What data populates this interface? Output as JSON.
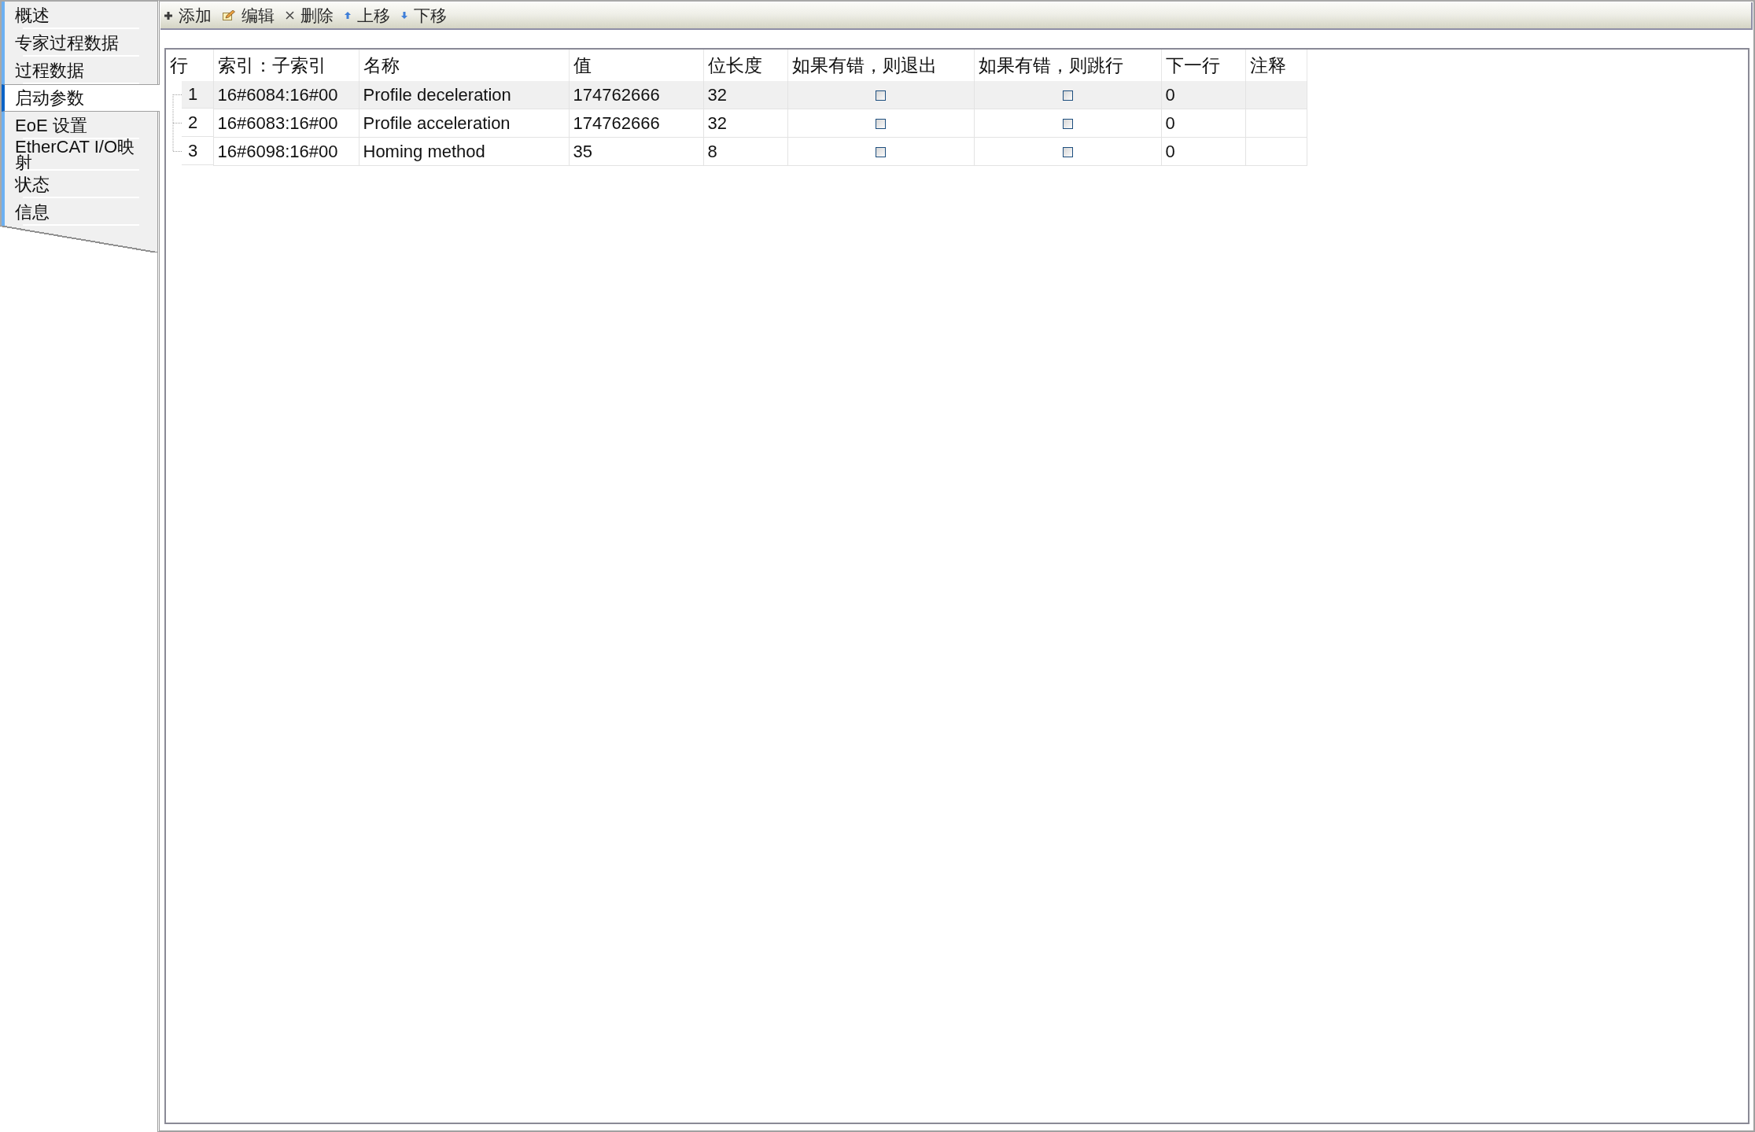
{
  "sidebar": {
    "items": [
      {
        "label": "概述",
        "selected": false
      },
      {
        "label": "专家过程数据",
        "selected": false
      },
      {
        "label": "过程数据",
        "selected": false
      },
      {
        "label": "启动参数",
        "selected": true
      },
      {
        "label": "EoE 设置",
        "selected": false
      },
      {
        "label": "EtherCAT I/O映射",
        "selected": false
      },
      {
        "label": "状态",
        "selected": false
      },
      {
        "label": "信息",
        "selected": false
      }
    ]
  },
  "toolbar": {
    "buttons": [
      {
        "kind": "add",
        "label": "添加"
      },
      {
        "kind": "edit",
        "label": "编辑"
      },
      {
        "kind": "delete",
        "label": "删除"
      },
      {
        "kind": "move_up",
        "label": "上移"
      },
      {
        "kind": "move_down",
        "label": "下移"
      }
    ]
  },
  "table": {
    "columns": [
      "行",
      "索引：子索引",
      "名称",
      "值",
      "位长度",
      "如果有错，则退出",
      "如果有错，则跳行",
      "下一行",
      "注释"
    ],
    "rows": [
      {
        "line": "1",
        "index": "16#6084:16#00",
        "name": "Profile deceleration",
        "value": "174762666",
        "bit_length": "32",
        "exit_on_error": false,
        "jump_on_error": false,
        "next_line": "0",
        "selected": true
      },
      {
        "line": "2",
        "index": "16#6083:16#00",
        "name": "Profile acceleration",
        "value": "174762666",
        "bit_length": "32",
        "exit_on_error": false,
        "jump_on_error": false,
        "next_line": "0",
        "selected": false
      },
      {
        "line": "3",
        "index": "16#6098:16#00",
        "name": "Homing method",
        "value": "35",
        "bit_length": "8",
        "exit_on_error": false,
        "jump_on_error": false,
        "next_line": "0",
        "selected": false
      }
    ]
  }
}
